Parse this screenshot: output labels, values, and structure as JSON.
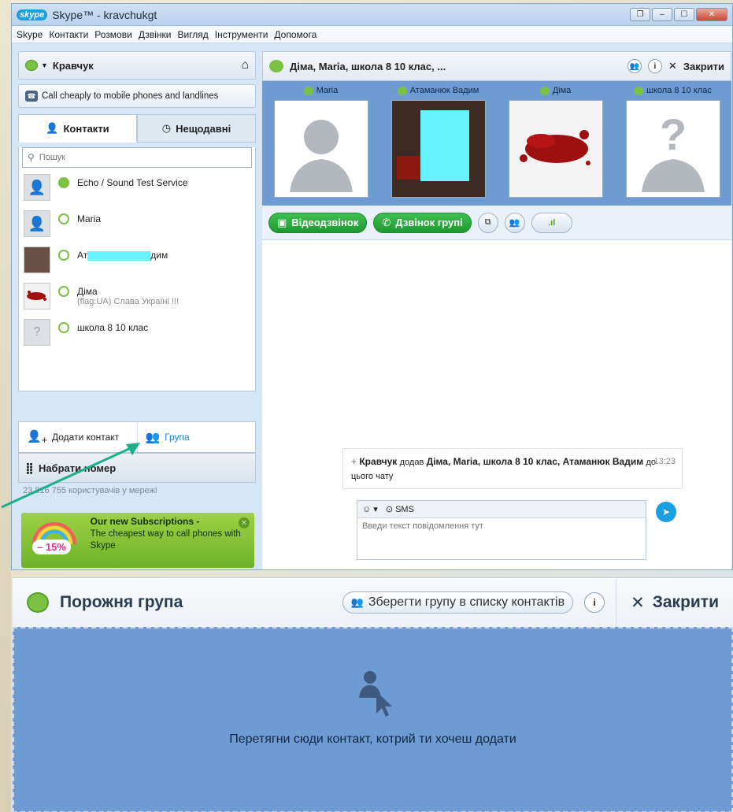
{
  "window": {
    "logo": "skype",
    "title": "Skype™ - kravchukgt"
  },
  "menu": [
    "Skype",
    "Контакти",
    "Розмови",
    "Дзвінки",
    "Вигляд",
    "Інструменти",
    "Допомога"
  ],
  "profile": {
    "name": "Кравчук"
  },
  "call_cheap": "Call cheaply to mobile phones and landlines",
  "tabs": {
    "contacts": "Контакти",
    "recent": "Нещодавні"
  },
  "search": {
    "placeholder": "Пошук"
  },
  "contacts": [
    {
      "name": "Echo / Sound Test Service",
      "mood": "",
      "online": true
    },
    {
      "name": "Maria",
      "mood": "",
      "online": false
    },
    {
      "name_prefix": "Ат",
      "name_suffix": "дим",
      "mood": "",
      "online": false
    },
    {
      "name": "Діма",
      "mood": "(flag:UA) Слава Україні !!!",
      "online": false
    },
    {
      "name": "школа 8 10 клас",
      "mood": "",
      "online": false
    }
  ],
  "add_contact": "Додати контакт",
  "group": "Група",
  "dial": "Набрати номер",
  "users_online": "23 816 755 користувачів у мережі",
  "promo": {
    "title": "Our new Subscriptions -",
    "text": "The cheapest way to call phones with Skype",
    "badge": "– 15%"
  },
  "conversation": {
    "title": "Діма, Maria, школа 8 10 клас, ...",
    "close": "Закрити",
    "participants": [
      "Maria",
      "Атаманюк Вадим",
      "Діма",
      "школа 8 10 клас"
    ],
    "video_call": "Відеодзвінок",
    "group_call": "Дзвінок групі",
    "message": {
      "author": "Кравчук",
      "verb": "додав",
      "added": "Діма, Maria, школа 8 10 клас, Атаманюк Вадим",
      "tail": "до цього чату",
      "time": "13:23"
    },
    "sms": "SMS",
    "input_placeholder": "Введи текст повідомлення тут"
  },
  "group_panel": {
    "title": "Порожня група",
    "save": "Зберегти групу в списку контактів",
    "close": "Закрити",
    "drop_text": "Перетягни сюди контакт, котрий ти хочеш додати"
  },
  "colors": {
    "accent": "#1aa0e0",
    "online": "#7bc144",
    "participants_bg": "#6f9bd3",
    "arrow": "#1bb08a"
  }
}
